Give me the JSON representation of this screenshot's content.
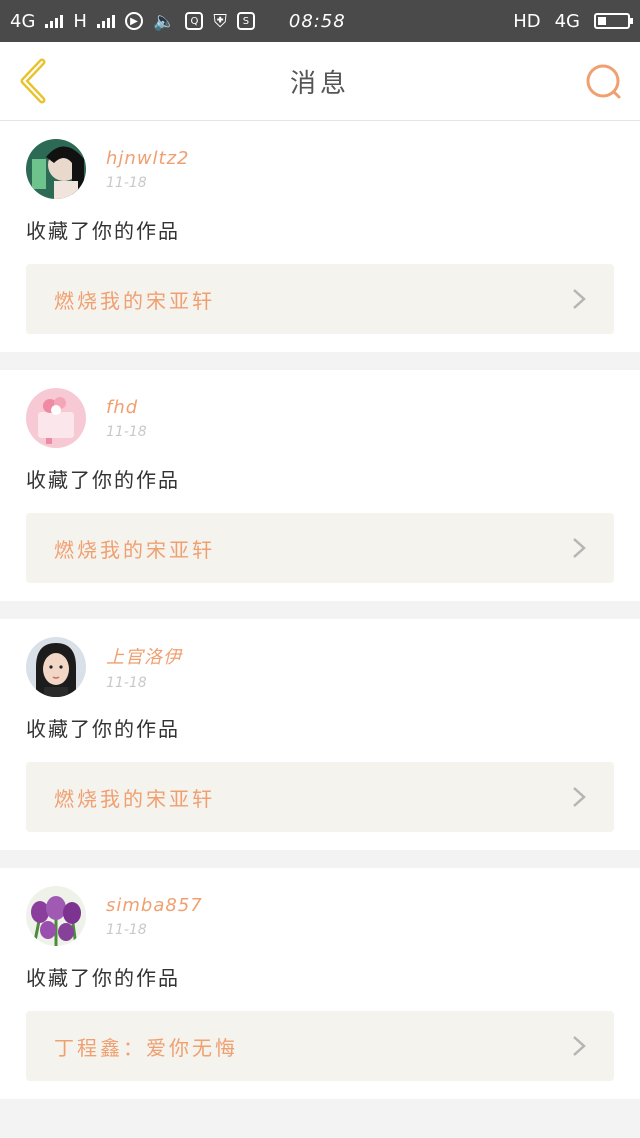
{
  "status_bar": {
    "network1": "4G",
    "network2": "H",
    "time": "08:58",
    "hd": "HD",
    "network3": "4G"
  },
  "header": {
    "title": "消息",
    "back_icon": "chevron-left-icon",
    "search_icon": "search-icon"
  },
  "colors": {
    "accent": "#f0a070",
    "back": "#e8c32e",
    "card_work_bg": "#f4f3ee"
  },
  "messages": [
    {
      "username": "hjnwltz2",
      "date": "11-18",
      "action": "收藏了你的作品",
      "work_title": "燃烧我的宋亚轩",
      "avatar": "avatar-dark-hair"
    },
    {
      "username": "fhd",
      "date": "11-18",
      "action": "收藏了你的作品",
      "work_title": "燃烧我的宋亚轩",
      "avatar": "avatar-pink-cake"
    },
    {
      "username": "上官洛伊",
      "date": "11-18",
      "action": "收藏了你的作品",
      "work_title": "燃烧我的宋亚轩",
      "avatar": "avatar-girl-face"
    },
    {
      "username": "simba857",
      "date": "11-18",
      "action": "收藏了你的作品",
      "work_title": "丁程鑫：爱你无悔",
      "avatar": "avatar-tulips"
    }
  ]
}
